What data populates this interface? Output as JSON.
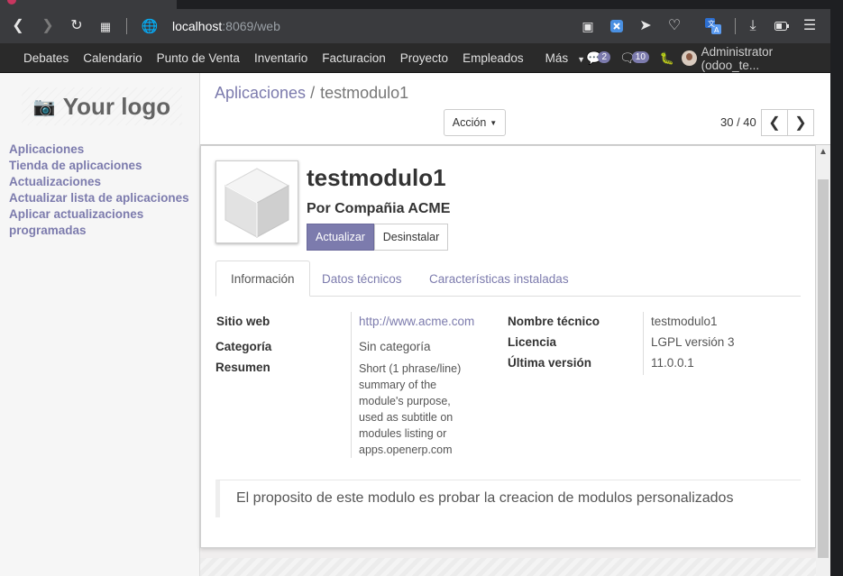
{
  "browser": {
    "url_host": "localhost",
    "url_rest": ":8069/web"
  },
  "navbar": {
    "menu": [
      "Debates",
      "Calendario",
      "Punto de Venta",
      "Inventario",
      "Facturacion",
      "Proyecto",
      "Empleados",
      "Más"
    ],
    "chat_count": "2",
    "activity_count": "10",
    "user": "Administrator (odoo_te..."
  },
  "sidebar": {
    "logo_text": "Your logo",
    "links": [
      "Aplicaciones",
      "Tienda de aplicaciones",
      "Actualizaciones",
      "Actualizar lista de aplicaciones",
      "Aplicar actualizaciones",
      "programadas"
    ]
  },
  "control_panel": {
    "breadcrumb_parent": "Aplicaciones",
    "breadcrumb_separator": "/",
    "breadcrumb_current": "testmodulo1",
    "action_label": "Acción",
    "pager": "30 / 40"
  },
  "module": {
    "name": "testmodulo1",
    "author": "Por Compañia ACME",
    "update_button": "Actualizar",
    "uninstall_button": "Desinstalar",
    "tabs": [
      "Información",
      "Datos técnicos",
      "Características instaladas"
    ],
    "fields": {
      "website_label": "Sitio web",
      "website": "http://www.acme.com",
      "category_label": "Categoría",
      "category": "Sin categoría",
      "summary_label": "Resumen",
      "summary": "Short (1 phrase/line) summary of the module's purpose, used as subtitle on modules listing or apps.openerp.com",
      "technical_name_label": "Nombre técnico",
      "technical_name": "testmodulo1",
      "license_label": "Licencia",
      "license": "LGPL versión 3",
      "latest_version_label": "Última versión",
      "latest_version": "11.0.0.1"
    },
    "description": "El proposito de este modulo es probar la creacion de modulos personalizados"
  },
  "colors": {
    "brand": "#7c7bad",
    "navbar": "#2a2a2a",
    "browser_chrome": "#3a3b3e"
  }
}
